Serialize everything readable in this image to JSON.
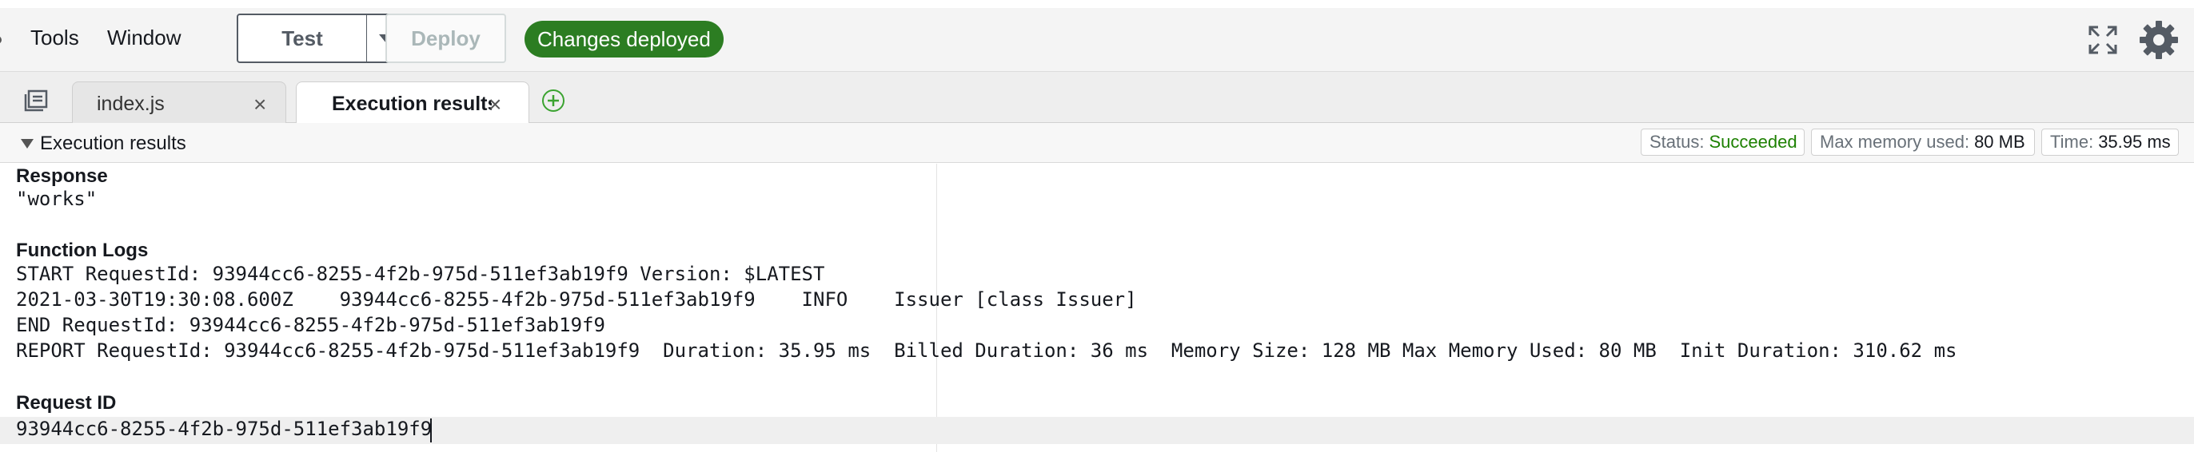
{
  "toolbar": {
    "menu": [
      "Tools",
      "Window"
    ],
    "test_label": "Test",
    "deploy_label": "Deploy",
    "deploy_status": "Changes deployed",
    "icons": [
      "expand-icon",
      "gear-icon"
    ]
  },
  "tabs": [
    {
      "label": "index.js",
      "active": false
    },
    {
      "label": "Execution results",
      "active": true
    }
  ],
  "results": {
    "title": "Execution results",
    "status_key": "Status:",
    "status_value": "Succeeded",
    "memory_key": "Max memory used:",
    "memory_value": "80 MB",
    "time_key": "Time:",
    "time_value": "35.95 ms"
  },
  "response": {
    "heading": "Response",
    "value": "\"works\""
  },
  "function_logs": {
    "heading": "Function Logs",
    "lines": [
      "START RequestId: 93944cc6-8255-4f2b-975d-511ef3ab19f9 Version: $LATEST",
      "2021-03-30T19:30:08.600Z\t93944cc6-8255-4f2b-975d-511ef3ab19f9\tINFO\tIssuer [class Issuer]",
      "END RequestId: 93944cc6-8255-4f2b-975d-511ef3ab19f9",
      "REPORT RequestId: 93944cc6-8255-4f2b-975d-511ef3ab19f9  Duration: 35.95 ms  Billed Duration: 36 ms  Memory Size: 128 MB Max Memory Used: 80 MB  Init Duration: 310.62 ms"
    ]
  },
  "request_id": {
    "heading": "Request ID",
    "value": "93944cc6-8255-4f2b-975d-511ef3ab19f9"
  },
  "colors": {
    "success": "#2c7d22",
    "status_ok_text": "#1d8102"
  }
}
